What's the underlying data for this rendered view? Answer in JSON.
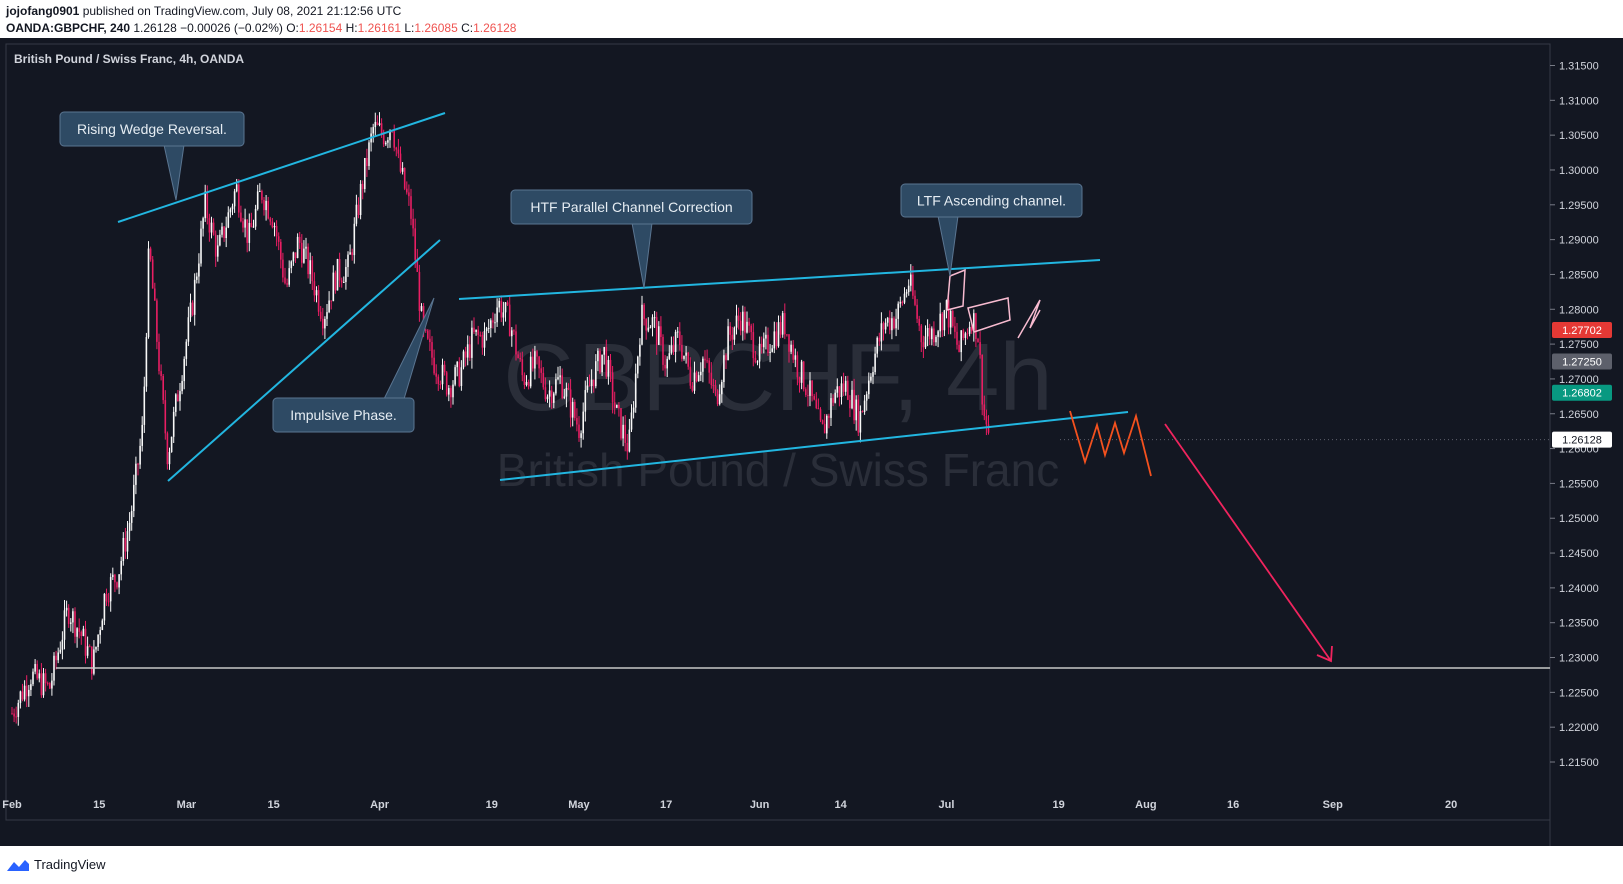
{
  "header": {
    "publisher": "jojofang0901",
    "published_text": "published on TradingView.com, July 08, 2021 21:12:56 UTC",
    "symbol": "OANDA:GBPCHF, 240",
    "last_price": "1.26128",
    "change": "−0.00026 (−0.02%)",
    "o_label": "O:",
    "o_value": "1.26154",
    "h_label": "H:",
    "h_value": "1.26161",
    "l_label": "L:",
    "l_value": "1.26085",
    "c_label": "C:",
    "c_value": "1.26128"
  },
  "footer": {
    "brand": "TradingView"
  },
  "colors": {
    "background": "#131722",
    "candle": "#e91e63",
    "candle_up": "#f8f8f8",
    "trendline": "#22b6e0",
    "arrow": "#f0245e",
    "wave": "#f4511e",
    "callout_bg": "#2e4a64",
    "support_line": "#c8c8c8"
  },
  "chart_data": {
    "type": "candlestick",
    "title": "British Pound / Swiss Franc, 4h, OANDA",
    "watermark": {
      "symbol": "GBPCHF, 4h",
      "name": "British Pound / Swiss Franc"
    },
    "y_ticks": [
      "1.31500",
      "1.31000",
      "1.30500",
      "1.30000",
      "1.29500",
      "1.29000",
      "1.28500",
      "1.28000",
      "1.27500",
      "1.27000",
      "1.26500",
      "1.26000",
      "1.25500",
      "1.25000",
      "1.24500",
      "1.24000",
      "1.23500",
      "1.23000",
      "1.22500",
      "1.22000",
      "1.21500"
    ],
    "ylim": [
      1.2105,
      1.318
    ],
    "x_ticks": [
      {
        "label": "Feb",
        "date": "2021-02-01"
      },
      {
        "label": "15",
        "date": "2021-02-15"
      },
      {
        "label": "Mar",
        "date": "2021-03-01"
      },
      {
        "label": "15",
        "date": "2021-03-15"
      },
      {
        "label": "Apr",
        "date": "2021-04-01"
      },
      {
        "label": "19",
        "date": "2021-04-19"
      },
      {
        "label": "May",
        "date": "2021-05-03"
      },
      {
        "label": "17",
        "date": "2021-05-17"
      },
      {
        "label": "Jun",
        "date": "2021-06-01"
      },
      {
        "label": "14",
        "date": "2021-06-14"
      },
      {
        "label": "Jul",
        "date": "2021-07-01"
      },
      {
        "label": "19",
        "date": "2021-07-19"
      },
      {
        "label": "Aug",
        "date": "2021-08-02"
      },
      {
        "label": "16",
        "date": "2021-08-16"
      },
      {
        "label": "Sep",
        "date": "2021-09-01"
      },
      {
        "label": "20",
        "date": "2021-09-20"
      }
    ],
    "price_badges": [
      {
        "value": "1.27702",
        "y": 1.27702,
        "bg": "#e53935",
        "fg": "#ffffff"
      },
      {
        "value": "1.27250",
        "y": 1.2725,
        "bg": "#5d606b",
        "fg": "#ffffff"
      },
      {
        "value": "1.26802",
        "y": 1.26802,
        "bg": "#089981",
        "fg": "#ffffff"
      },
      {
        "value": "1.26128",
        "y": 1.26128,
        "bg": "#ffffff",
        "fg": "#131722"
      }
    ],
    "price_path": [
      [
        "2021-02-01",
        1.222
      ],
      [
        "2021-02-04",
        1.2275
      ],
      [
        "2021-02-07",
        1.2255
      ],
      [
        "2021-02-10",
        1.237
      ],
      [
        "2021-02-12",
        1.2335
      ],
      [
        "2021-02-14",
        1.229
      ],
      [
        "2021-02-16",
        1.2395
      ],
      [
        "2021-02-18",
        1.242
      ],
      [
        "2021-02-20",
        1.25
      ],
      [
        "2021-02-22",
        1.263
      ],
      [
        "2021-02-23",
        1.289
      ],
      [
        "2021-02-25",
        1.268
      ],
      [
        "2021-02-26",
        1.259
      ],
      [
        "2021-02-28",
        1.27
      ],
      [
        "2021-03-02",
        1.281
      ],
      [
        "2021-03-04",
        1.295
      ],
      [
        "2021-03-06",
        1.288
      ],
      [
        "2021-03-09",
        1.2975
      ],
      [
        "2021-03-11",
        1.29
      ],
      [
        "2021-03-13",
        1.297
      ],
      [
        "2021-03-15",
        1.293
      ],
      [
        "2021-03-17",
        1.283
      ],
      [
        "2021-03-19",
        1.29
      ],
      [
        "2021-03-21",
        1.285
      ],
      [
        "2021-03-23",
        1.279
      ],
      [
        "2021-03-25",
        1.285
      ],
      [
        "2021-03-27",
        1.286
      ],
      [
        "2021-03-29",
        1.297
      ],
      [
        "2021-03-31",
        1.306
      ],
      [
        "2021-04-02",
        1.305
      ],
      [
        "2021-04-03",
        1.307
      ],
      [
        "2021-04-04",
        1.301
      ],
      [
        "2021-04-06",
        1.294
      ],
      [
        "2021-04-07",
        1.285
      ],
      [
        "2021-04-08",
        1.276
      ],
      [
        "2021-04-10",
        1.272
      ],
      [
        "2021-04-12",
        1.269
      ],
      [
        "2021-04-14",
        1.271
      ],
      [
        "2021-04-16",
        1.276
      ],
      [
        "2021-04-18",
        1.276
      ],
      [
        "2021-04-20",
        1.281
      ],
      [
        "2021-04-22",
        1.278
      ],
      [
        "2021-04-24",
        1.27
      ],
      [
        "2021-04-26",
        1.272
      ],
      [
        "2021-04-28",
        1.268
      ],
      [
        "2021-04-30",
        1.27
      ],
      [
        "2021-05-03",
        1.263
      ],
      [
        "2021-05-05",
        1.27
      ],
      [
        "2021-05-07",
        1.274
      ],
      [
        "2021-05-09",
        1.265
      ],
      [
        "2021-05-11",
        1.26
      ],
      [
        "2021-05-13",
        1.279
      ],
      [
        "2021-05-15",
        1.278
      ],
      [
        "2021-05-17",
        1.272
      ],
      [
        "2021-05-19",
        1.276
      ],
      [
        "2021-05-21",
        1.27
      ],
      [
        "2021-05-23",
        1.273
      ],
      [
        "2021-05-25",
        1.267
      ],
      [
        "2021-05-27",
        1.276
      ],
      [
        "2021-05-29",
        1.279
      ],
      [
        "2021-06-01",
        1.273
      ],
      [
        "2021-06-03",
        1.276
      ],
      [
        "2021-06-05",
        1.278
      ],
      [
        "2021-06-07",
        1.272
      ],
      [
        "2021-06-09",
        1.268
      ],
      [
        "2021-06-11",
        1.262
      ],
      [
        "2021-06-13",
        1.268
      ],
      [
        "2021-06-15",
        1.269
      ],
      [
        "2021-06-17",
        1.264
      ],
      [
        "2021-06-19",
        1.272
      ],
      [
        "2021-06-21",
        1.278
      ],
      [
        "2021-06-23",
        1.279
      ],
      [
        "2021-06-25",
        1.284
      ],
      [
        "2021-06-27",
        1.276
      ],
      [
        "2021-06-29",
        1.277
      ],
      [
        "2021-07-01",
        1.28
      ],
      [
        "2021-07-03",
        1.274
      ],
      [
        "2021-07-05",
        1.279
      ],
      [
        "2021-07-06",
        1.277
      ],
      [
        "2021-07-07",
        1.265
      ],
      [
        "2021-07-08",
        1.26128
      ]
    ],
    "annotations": [
      {
        "text": "Rising Wedge Reversal."
      },
      {
        "text": "HTF Parallel Channel Correction"
      },
      {
        "text": "LTF Ascending channel."
      },
      {
        "text": "Impulsive Phase."
      }
    ],
    "horizontal_support": 1.2285
  }
}
